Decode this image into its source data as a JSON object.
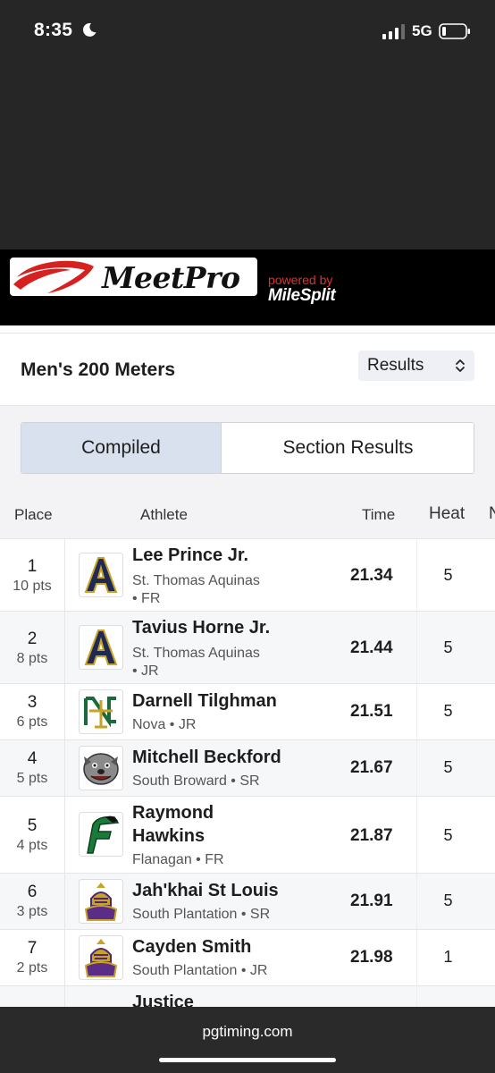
{
  "status_bar": {
    "time": "8:35",
    "network": "5G"
  },
  "brand": {
    "logo_text": "MeetPro",
    "powered_by": "powered by",
    "partner": "MileSplit"
  },
  "header": {
    "title": "Men's 200 Meters",
    "view_select": "Results"
  },
  "tabs": [
    {
      "label": "Compiled",
      "active": true
    },
    {
      "label": "Section Results",
      "active": false
    }
  ],
  "table": {
    "columns": {
      "place": "Place",
      "athlete": "Athlete",
      "time": "Time",
      "heat": "Heat",
      "extra": "N"
    },
    "rows": [
      {
        "place": "1",
        "pts": "10 pts",
        "name": "Lee Prince Jr.",
        "school": "St. Thomas Aquinas",
        "grade": "• FR",
        "time": "21.34",
        "heat": "5",
        "logo": "aquinas-logo-icon"
      },
      {
        "place": "2",
        "pts": "8 pts",
        "name": "Tavius Horne Jr.",
        "school": "St. Thomas Aquinas",
        "grade": "• JR",
        "time": "21.44",
        "heat": "5",
        "logo": "aquinas-logo-icon"
      },
      {
        "place": "3",
        "pts": "6 pts",
        "name": "Darnell Tilghman",
        "school": "Nova • JR",
        "time": "21.51",
        "heat": "5",
        "logo": "nova-logo-icon"
      },
      {
        "place": "4",
        "pts": "5 pts",
        "name": "Mitchell Beckford",
        "school": "South Broward • SR",
        "time": "21.67",
        "heat": "5",
        "logo": "bulldog-logo-icon"
      },
      {
        "place": "5",
        "pts": "4 pts",
        "name_line1": "Raymond",
        "name_line2": "Hawkins",
        "school": "Flanagan • FR",
        "time": "21.87",
        "heat": "5",
        "logo": "flanagan-logo-icon"
      },
      {
        "place": "6",
        "pts": "3 pts",
        "name": "Jah'khai St Louis",
        "school": "South Plantation • SR",
        "time": "21.91",
        "heat": "5",
        "logo": "paladin-logo-icon"
      },
      {
        "place": "7",
        "pts": "2 pts",
        "name": "Cayden Smith",
        "school": "South Plantation • JR",
        "time": "21.98",
        "heat": "1",
        "logo": "paladin-logo-icon"
      },
      {
        "name": "Justice"
      }
    ]
  },
  "footer": {
    "url": "pgtiming.com"
  }
}
